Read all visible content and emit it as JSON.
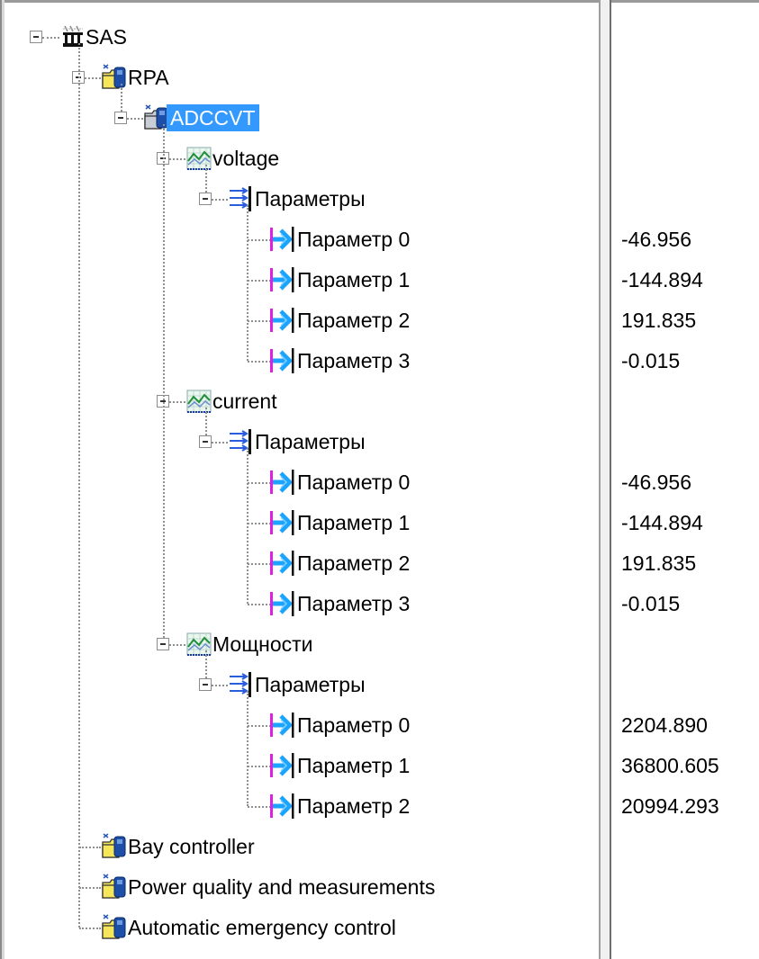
{
  "tree": {
    "root": {
      "label": "SAS",
      "icon": "substation-icon"
    },
    "rpa": {
      "label": "RPA",
      "icon": "device-folder-icon"
    },
    "adccvt": {
      "label": "ADCCVT",
      "icon": "device-folder-grey-icon",
      "selected": true
    },
    "voltage": {
      "label": "voltage",
      "params_label": "Параметры",
      "items": [
        {
          "label": "Параметр 0",
          "value": "-46.956"
        },
        {
          "label": "Параметр 1",
          "value": "-144.894"
        },
        {
          "label": "Параметр 2",
          "value": "191.835"
        },
        {
          "label": "Параметр 3",
          "value": "-0.015"
        }
      ]
    },
    "current": {
      "label": "current",
      "params_label": "Параметры",
      "items": [
        {
          "label": "Параметр 0",
          "value": "-46.956"
        },
        {
          "label": "Параметр 1",
          "value": "-144.894"
        },
        {
          "label": "Параметр 2",
          "value": "191.835"
        },
        {
          "label": "Параметр 3",
          "value": "-0.015"
        }
      ]
    },
    "power": {
      "label": "Мощности",
      "params_label": "Параметры",
      "items": [
        {
          "label": "Параметр 0",
          "value": "2204.890"
        },
        {
          "label": "Параметр 1",
          "value": "36800.605"
        },
        {
          "label": "Параметр 2",
          "value": "20994.293"
        }
      ]
    },
    "siblings": [
      {
        "label": "Bay controller"
      },
      {
        "label": "Power quality and measurements"
      },
      {
        "label": "Automatic emergency control"
      }
    ]
  },
  "colors": {
    "selection": "#3399ff",
    "param_arrow": "#1aa3ff",
    "param_bar": "#e020e0"
  }
}
